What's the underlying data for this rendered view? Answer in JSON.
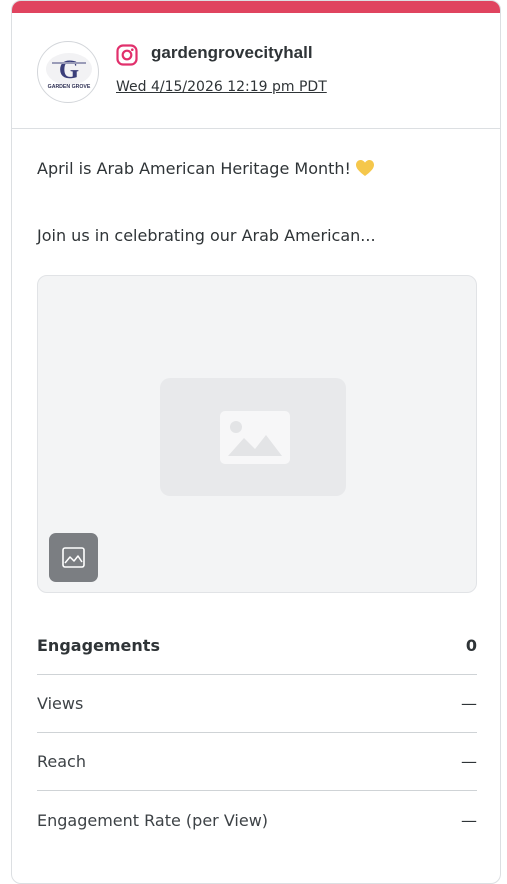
{
  "post": {
    "account": "gardengrovecityhall",
    "timestamp": "Wed 4/15/2026 12:19 pm PDT",
    "avatar_text_main": "G",
    "avatar_text_sub": "GARDEN GROVE",
    "text_line_1": "April is Arab American Heritage Month!",
    "text_line_2": "Join us in celebrating our Arab American...",
    "platform_icon": "instagram-icon",
    "emoji_icon": "yellow-heart-icon",
    "media_icon": "image-placeholder-icon"
  },
  "metrics": [
    {
      "label": "Engagements",
      "value": "0"
    },
    {
      "label": "Views",
      "value": "—"
    },
    {
      "label": "Reach",
      "value": "—"
    },
    {
      "label": "Engagement Rate (per View)",
      "value": "—"
    }
  ],
  "colors": {
    "accent_bar": "#e0445f",
    "instagram": "#e1306c",
    "heart": "#f5c74b"
  }
}
